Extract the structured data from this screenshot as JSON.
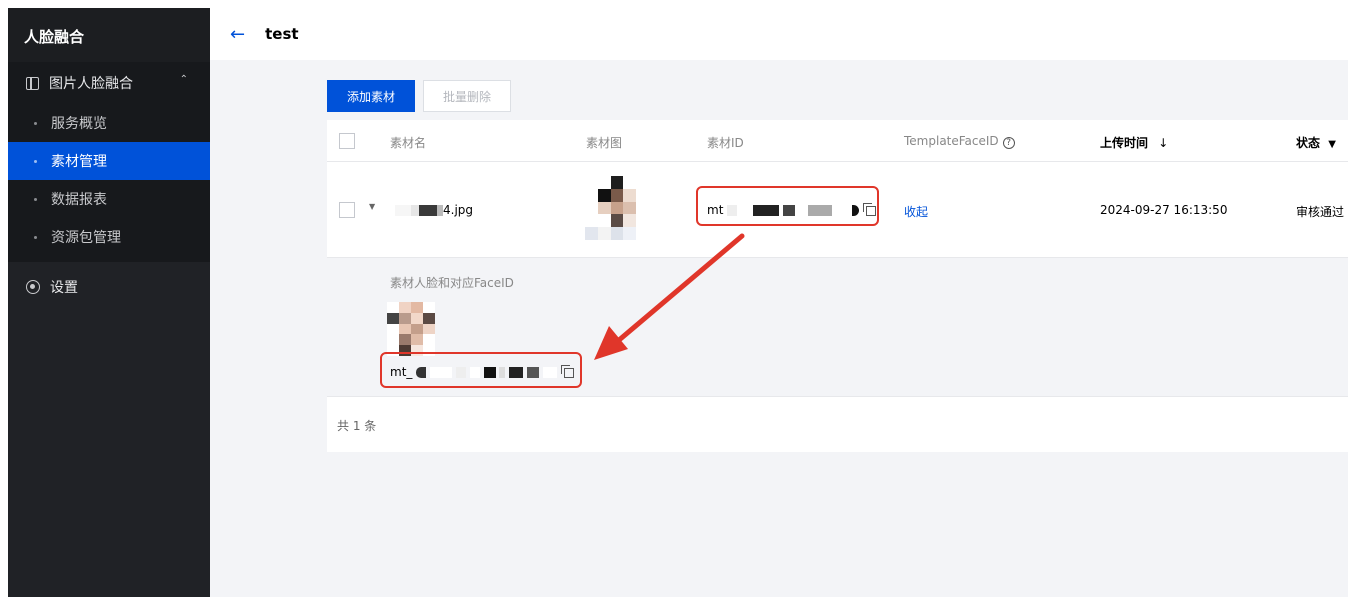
{
  "sidebar": {
    "brand": "人脸融合",
    "group_label": "图片人脸融合",
    "items": [
      {
        "label": "服务概览",
        "active": false
      },
      {
        "label": "素材管理",
        "active": true
      },
      {
        "label": "数据报表",
        "active": false
      },
      {
        "label": "资源包管理",
        "active": false
      }
    ],
    "settings_label": "设置"
  },
  "header": {
    "back_icon": "←",
    "title": "test"
  },
  "toolbar": {
    "add_label": "添加素材",
    "batch_delete_label": "批量删除"
  },
  "table": {
    "columns": {
      "name": "素材名",
      "image": "素材图",
      "id": "素材ID",
      "template_face_id": "TemplateFaceID",
      "upload_time": "上传时间",
      "upload_time_sort": "↓",
      "status": "状态",
      "status_filter": "▼"
    },
    "rows": [
      {
        "name_suffix": "4.jpg",
        "id_prefix": "mt",
        "template_action": "收起",
        "upload_time": "2024-09-27 16:13:50",
        "status": "审核通过"
      }
    ],
    "expanded": {
      "label": "素材人脸和对应FaceID",
      "face_id_prefix": "mt_"
    },
    "footer_text": "共 1 条"
  },
  "colors": {
    "brand_blue": "#0052d9",
    "sidebar_bg": "#202226",
    "annotation_red": "#e0362a"
  }
}
